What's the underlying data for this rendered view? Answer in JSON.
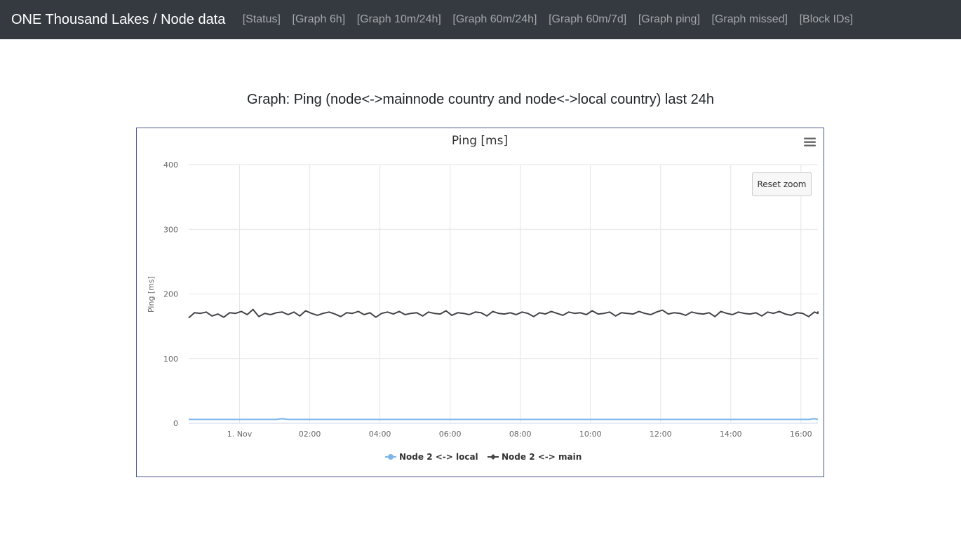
{
  "navbar": {
    "brand": "ONE Thousand Lakes / Node data",
    "links": [
      "[Status]",
      "[Graph 6h]",
      "[Graph 10m/24h]",
      "[Graph 60m/24h]",
      "[Graph 60m/7d]",
      "[Graph ping]",
      "[Graph missed]",
      "[Block IDs]"
    ]
  },
  "page": {
    "heading": "Graph: Ping (node<->mainnode country and node<->local country) last 24h"
  },
  "chart_controls": {
    "reset_zoom_label": "Reset zoom",
    "menu_icon": "hamburger-menu-icon"
  },
  "chart_data": {
    "type": "line",
    "title": "Ping [ms]",
    "xlabel": "",
    "ylabel": "Ping [ms]",
    "ylim": [
      0,
      400
    ],
    "y_ticks": [
      0,
      100,
      200,
      300,
      400
    ],
    "x_range": [
      "2023-10-31 23:33",
      "2023-11-01 17:29"
    ],
    "x_ticks": [
      {
        "time": "2023-11-01 01:00",
        "label": "1. Nov"
      },
      {
        "time": "2023-11-01 03:00",
        "label": "02:00"
      },
      {
        "time": "2023-11-01 05:00",
        "label": "04:00"
      },
      {
        "time": "2023-11-01 07:00",
        "label": "06:00"
      },
      {
        "time": "2023-11-01 09:00",
        "label": "08:00"
      },
      {
        "time": "2023-11-01 11:00",
        "label": "10:00"
      },
      {
        "time": "2023-11-01 13:00",
        "label": "12:00"
      },
      {
        "time": "2023-11-01 15:00",
        "label": "14:00"
      },
      {
        "time": "2023-11-01 17:00",
        "label": "16:00"
      }
    ],
    "grid": true,
    "legend_position": "bottom-center",
    "series": [
      {
        "name": "Node 2 <-> local",
        "color": "#7cb5ec",
        "marker": "circle",
        "start": "2023-10-31 23:33",
        "interval_minutes": 10,
        "values": [
          6,
          6,
          6,
          6,
          6,
          6,
          6,
          6,
          6,
          6,
          6,
          6,
          6,
          6,
          6,
          6,
          7,
          6,
          6,
          6,
          6,
          6,
          6,
          6,
          6,
          6,
          6,
          6,
          6,
          6,
          6,
          6,
          6,
          6,
          6,
          6,
          6,
          6,
          6,
          6,
          6,
          6,
          6,
          6,
          6,
          6,
          6,
          6,
          6,
          6,
          6,
          6,
          6,
          6,
          6,
          6,
          6,
          6,
          6,
          6,
          6,
          6,
          6,
          6,
          6,
          6,
          6,
          6,
          6,
          6,
          6,
          6,
          6,
          6,
          6,
          6,
          6,
          6,
          6,
          6,
          6,
          6,
          6,
          6,
          6,
          6,
          6,
          6,
          6,
          6,
          6,
          6,
          6,
          6,
          6,
          6,
          6,
          6,
          6,
          6,
          6,
          6,
          6,
          6,
          6,
          6,
          6,
          7,
          6,
          6
        ]
      },
      {
        "name": "Node 2 <-> main",
        "color": "#434348",
        "marker": "diamond",
        "start": "2023-10-31 23:33",
        "interval_minutes": 10,
        "values": [
          163,
          171,
          170,
          172,
          166,
          169,
          164,
          171,
          170,
          173,
          168,
          176,
          165,
          170,
          168,
          171,
          172,
          168,
          172,
          166,
          174,
          170,
          167,
          170,
          172,
          169,
          165,
          171,
          170,
          173,
          168,
          171,
          164,
          170,
          172,
          169,
          173,
          168,
          170,
          171,
          166,
          172,
          170,
          169,
          174,
          167,
          171,
          170,
          168,
          172,
          171,
          166,
          173,
          170,
          169,
          171,
          168,
          172,
          170,
          165,
          171,
          169,
          173,
          170,
          167,
          172,
          170,
          171,
          168,
          174,
          169,
          170,
          172,
          166,
          171,
          170,
          169,
          173,
          170,
          168,
          172,
          175,
          169,
          171,
          170,
          167,
          172,
          170,
          169,
          171,
          165,
          173,
          170,
          168,
          172,
          170,
          169,
          171,
          166,
          172,
          170,
          173,
          169,
          167,
          171,
          170,
          165,
          172,
          170,
          171,
          173
        ]
      }
    ]
  }
}
